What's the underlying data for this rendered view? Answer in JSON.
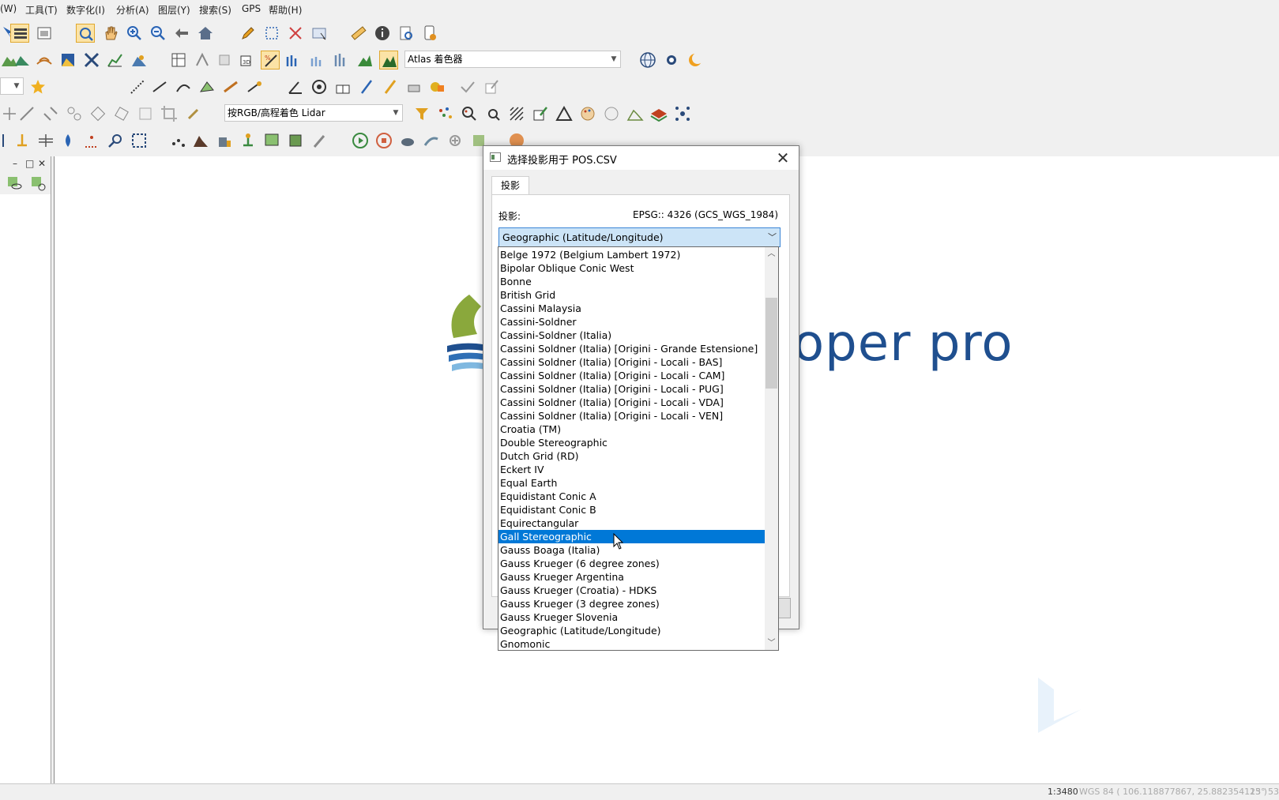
{
  "menu": [
    "(W)",
    "工具(T)",
    "数字化(I)",
    "分析(A)",
    "图层(Y)",
    "搜索(S)",
    "GPS",
    "帮助(H)"
  ],
  "toolbar": {
    "atlas_combo": "Atlas 着色器",
    "lidar_combo": "按RGB/高程着色 Lidar"
  },
  "map": {
    "logo_text": "oper pro"
  },
  "status": {
    "scale": "1:3480",
    "coords": "WGS 84 ( 106.118877867, 25.882354113 )",
    "dms": "25° 53'"
  },
  "dialog": {
    "title": "选择投影用于 POS.CSV",
    "tab": "投影",
    "projection_label": "投影:",
    "epsg": "EPSG:: 4326 (GCS_WGS_1984)",
    "selected": "Geographic (Latitude/Longitude)"
  },
  "dropdown": {
    "items": [
      "Belge 1972 (Belgium Lambert 1972)",
      "Bipolar Oblique Conic West",
      "Bonne",
      "British Grid",
      "Cassini Malaysia",
      "Cassini-Soldner",
      "Cassini-Soldner (Italia)",
      "Cassini Soldner (Italia) [Origini - Grande Estensione]",
      "Cassini Soldner (Italia) [Origini - Locali - BAS]",
      "Cassini Soldner (Italia) [Origini - Locali - CAM]",
      "Cassini Soldner (Italia) [Origini - Locali - PUG]",
      "Cassini Soldner (Italia) [Origini - Locali - VDA]",
      "Cassini Soldner (Italia) [Origini - Locali - VEN]",
      "Croatia (TM)",
      "Double Stereographic",
      "Dutch Grid (RD)",
      "Eckert IV",
      "Equal Earth",
      "Equidistant Conic A",
      "Equidistant Conic B",
      "Equirectangular",
      "Gall Stereographic",
      "Gauss Boaga (Italia)",
      "Gauss Krueger (6 degree zones)",
      "Gauss Krueger Argentina",
      "Gauss Krueger (Croatia) - HDKS",
      "Gauss Krueger (3 degree zones)",
      "Gauss Krueger Slovenia",
      "Geographic (Latitude/Longitude)",
      "Gnomonic"
    ],
    "highlighted_index": 21
  },
  "colors": {
    "accent": "#0078d7",
    "logo_blue": "#1f4f8f",
    "logo_green": "#8aa83c"
  }
}
